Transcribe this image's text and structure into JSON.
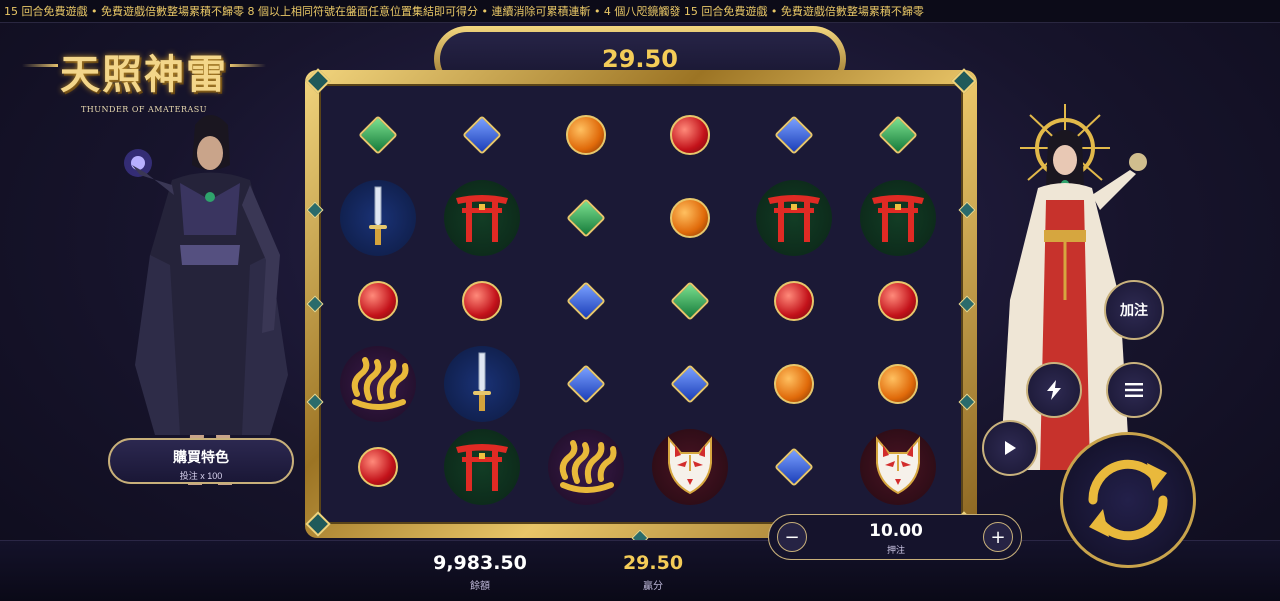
{
  "ticker": "15 回合免費遊戲 • 免費遊戲倍數整場累積不歸零          8 個以上相同符號在盤面任意位置集結即可得分 • 連續消除可累積連斬 • 4 個八咫鏡觸發 15 回合免費遊戲 • 免費遊戲倍數整場累積不歸零",
  "logo": {
    "title": "天照神雷",
    "subtitle": "THUNDER OF AMATERASU"
  },
  "win_display": "29.50",
  "buy_feature": {
    "label": "購買特色",
    "sub": "投注 x 100"
  },
  "stats": {
    "balance_value": "9,983.50",
    "balance_label": "餘額",
    "win_value": "29.50",
    "win_label": "贏分"
  },
  "stake": {
    "value": "10.00",
    "label": "押注",
    "minus": "−",
    "plus": "+"
  },
  "controls": {
    "add_bet": "加注"
  },
  "colors": {
    "gold": "#e7c76c",
    "panel": "#1b1936",
    "win_text": "#f4cc58"
  },
  "grid": {
    "columns": 6,
    "rows": 5,
    "cells": [
      "green-gem",
      "blue-gem",
      "orange-orb",
      "red-orb",
      "blue-gem",
      "green-gem",
      "katana",
      "torii",
      "green-gem",
      "orange-orb",
      "torii",
      "torii",
      "red-orb",
      "red-orb",
      "blue-gem",
      "green-gem",
      "red-orb",
      "red-orb",
      "serpent",
      "katana",
      "blue-gem",
      "blue-gem",
      "orange-orb",
      "orange-orb",
      "red-orb",
      "torii",
      "serpent",
      "kitsune-mask",
      "blue-gem",
      "kitsune-mask"
    ]
  }
}
